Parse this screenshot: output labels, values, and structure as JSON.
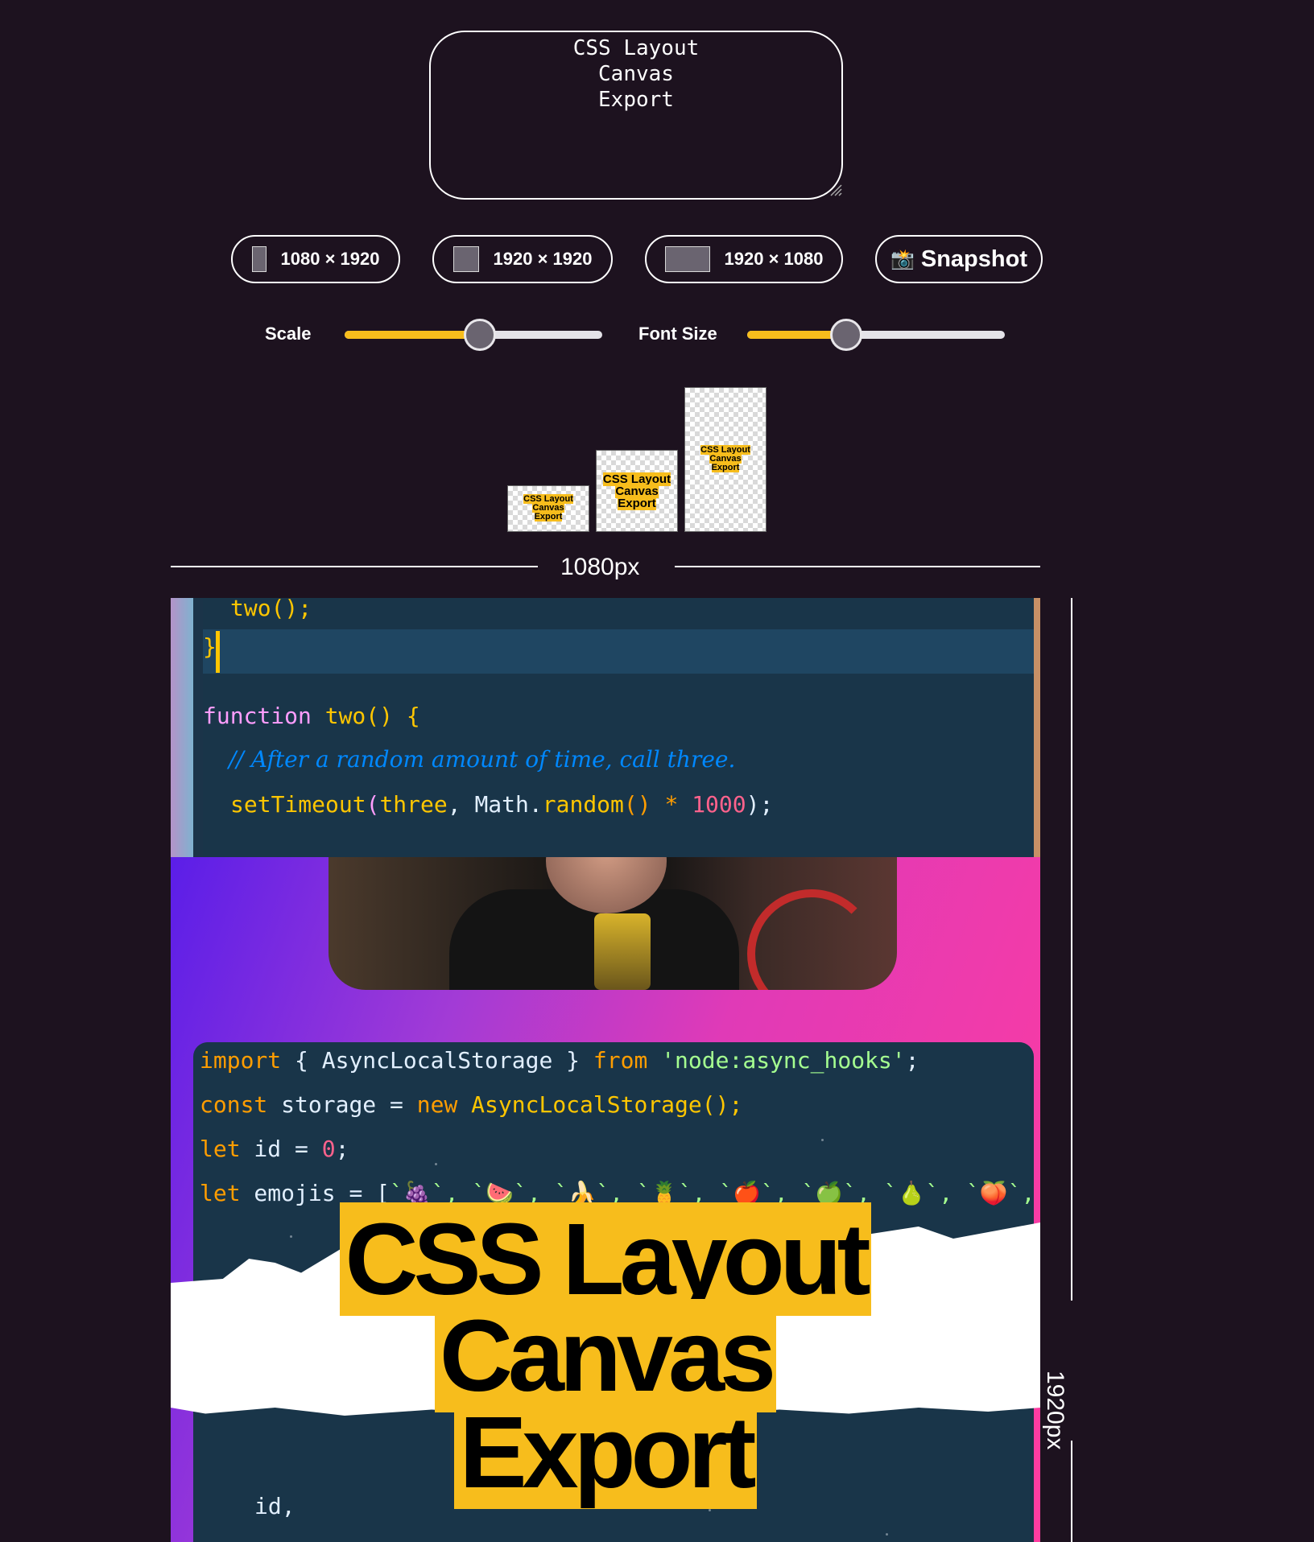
{
  "title_input": {
    "value": "CSS Layout\nCanvas\nExport"
  },
  "size_buttons": [
    {
      "label": "1080 × 1920"
    },
    {
      "label": "1920 × 1920"
    },
    {
      "label": "1920 × 1080"
    }
  ],
  "snapshot_button": {
    "icon": "camera-flash-icon",
    "label": "Snapshot"
  },
  "sliders": {
    "scale": {
      "label": "Scale",
      "value_fraction": 0.52
    },
    "font_size": {
      "label": "Font Size",
      "value_fraction": 0.38
    }
  },
  "previews": [
    {
      "lines": [
        "CSS Layout",
        "Canvas",
        "Export"
      ]
    },
    {
      "lines": [
        "CSS Layout",
        "Canvas",
        "Export"
      ]
    },
    {
      "lines": [
        "CSS Layout",
        "Canvas",
        "Export"
      ]
    }
  ],
  "ruler": {
    "width_label": "1080px",
    "height_label": "1920px"
  },
  "canvas": {
    "top_code": {
      "l1": "two();",
      "l2": "}",
      "l3_kw": "function",
      "l3_fn": "two",
      "l3_rest": "() {",
      "l4_comment": "// After a random amount of time, call three.",
      "l5_fn": "setTimeout",
      "l5_a": "(",
      "l5_b": "three",
      "l5_c": ", Math.",
      "l5_d": "random",
      "l5_e": "() * ",
      "l5_num": "1000",
      "l5_f": ");"
    },
    "bottom_code": {
      "l1_kw": "import",
      "l1_a": " { AsyncLocalStorage } ",
      "l1_from": "from",
      "l1_str": "'node:async_hooks'",
      "l1_end": ";",
      "l2_kw": "const",
      "l2_a": " storage = ",
      "l2_new": "new",
      "l2_fn": " AsyncLocalStorage",
      "l2_end": "();",
      "l3_kw": "let",
      "l3_a": " id = ",
      "l3_num": "0",
      "l3_end": ";",
      "l4_kw": "let",
      "l4_a": " emojis = [",
      "l4_items": "`🍇`, `🍉`, `🍌`, `🍍`, `🍎`, `🍏`, `🍐`, `🍑`,",
      "l5": "id,"
    },
    "headline": [
      "CSS Layout",
      "Canvas",
      "Export"
    ]
  }
}
